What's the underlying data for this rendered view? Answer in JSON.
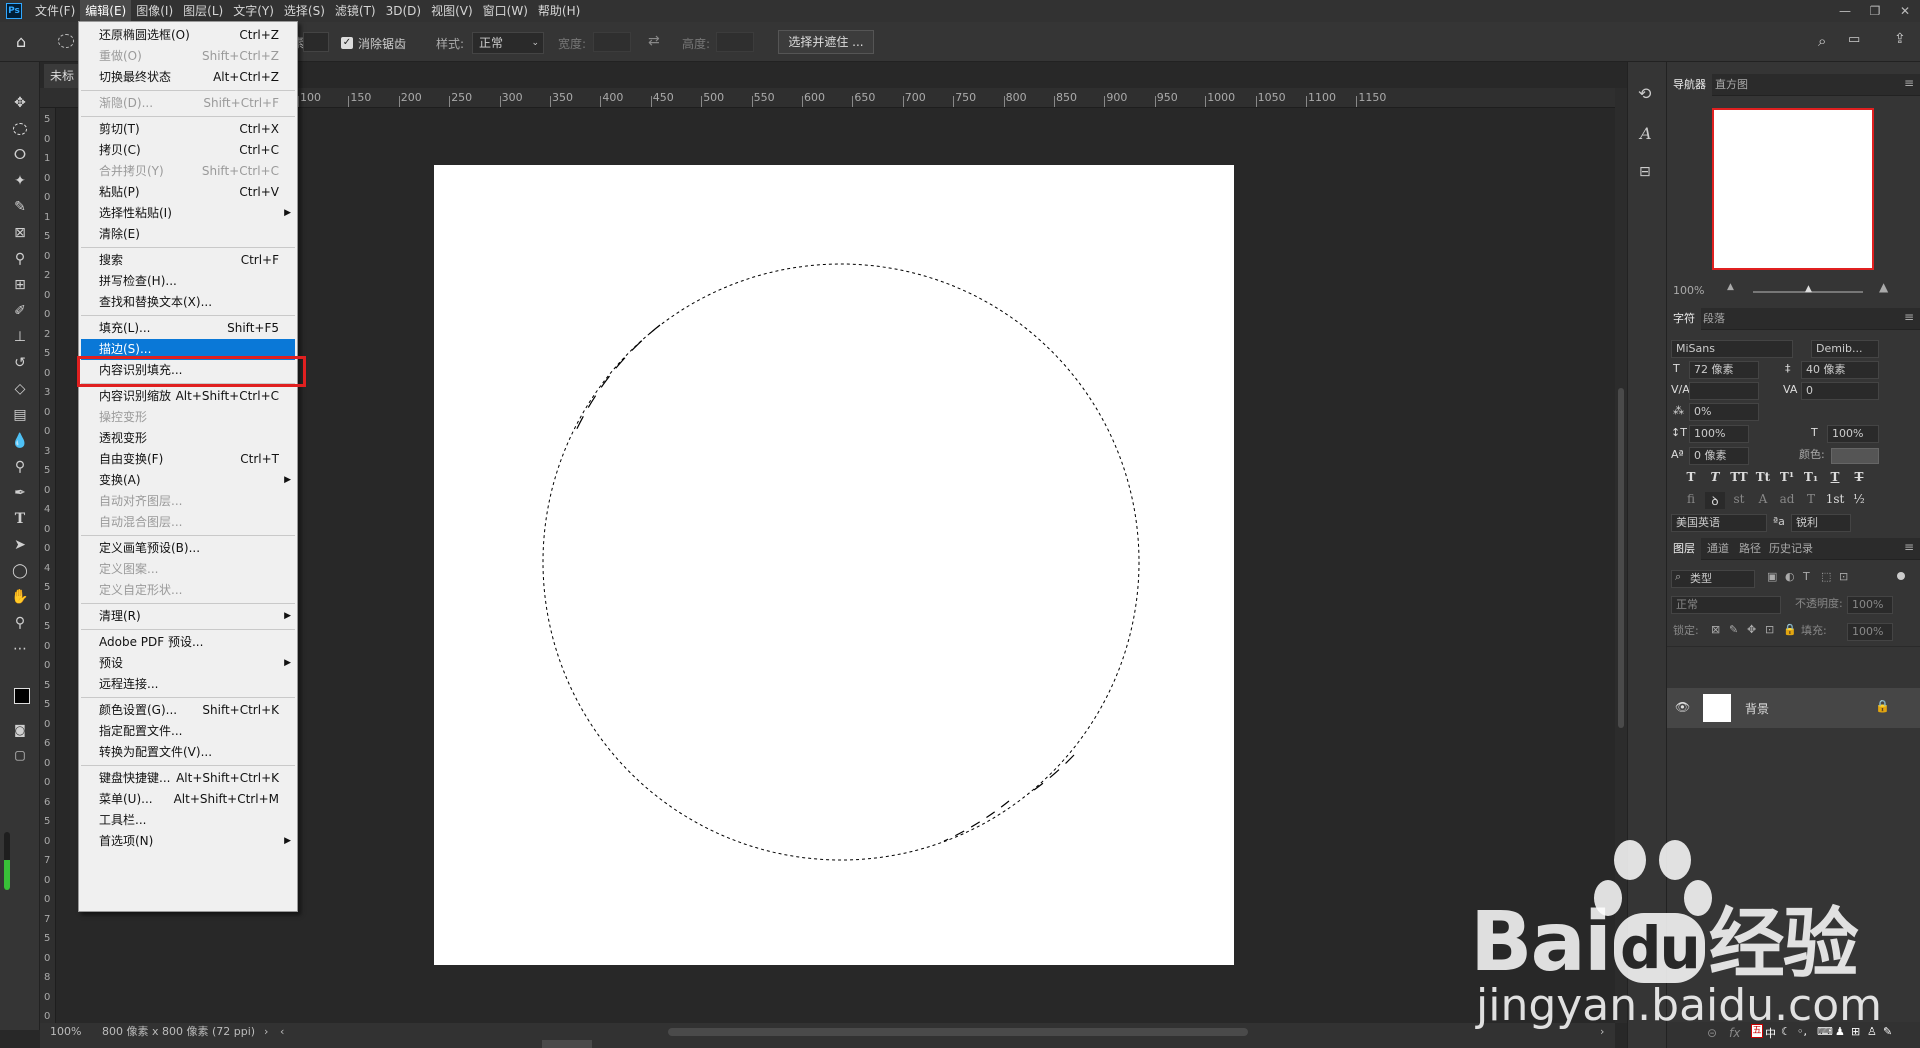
{
  "menubar": {
    "logo": "Ps",
    "items": [
      "文件(F)",
      "编辑(E)",
      "图像(I)",
      "图层(L)",
      "文字(Y)",
      "选择(S)",
      "滤镜(T)",
      "3D(D)",
      "视图(V)",
      "窗口(W)",
      "帮助(H)"
    ],
    "active_index": 1
  },
  "window_controls": [
    "—",
    "❐",
    "✕"
  ],
  "options_bar": {
    "partial_label": "素",
    "antialias_label": "消除锯齿",
    "style_label": "样式:",
    "style_value": "正常",
    "width_label": "宽度:",
    "height_label": "高度:",
    "select_mask_button": "选择并遮住 ..."
  },
  "document": {
    "tab_title": "未标",
    "zoom": "100%",
    "doc_info": "800 像素 x 800 像素 (72 ppi)"
  },
  "ruler_top_labels": [
    "100",
    "150",
    "200",
    "250",
    "300",
    "350",
    "400",
    "450",
    "500",
    "550",
    "600",
    "650",
    "700",
    "750",
    "800",
    "850",
    "900",
    "950",
    "1000",
    "1050",
    "1100",
    "1150"
  ],
  "ruler_left_labels": [
    "5",
    "0",
    "1",
    "0",
    "0",
    "1",
    "5",
    "0",
    "2",
    "0",
    "0",
    "2",
    "5",
    "0",
    "3",
    "0",
    "0",
    "3",
    "5",
    "0",
    "4",
    "0",
    "0",
    "4",
    "5",
    "0",
    "5",
    "0",
    "0",
    "5",
    "5",
    "0",
    "6",
    "0",
    "0",
    "6",
    "5",
    "0",
    "7",
    "0",
    "0",
    "7",
    "5",
    "0",
    "8",
    "0",
    "0"
  ],
  "edit_menu": {
    "items": [
      {
        "label": "还原椭圆选框(O)",
        "shortcut": "Ctrl+Z",
        "disabled": false
      },
      {
        "label": "重做(O)",
        "shortcut": "Shift+Ctrl+Z",
        "disabled": true
      },
      {
        "label": "切换最终状态",
        "shortcut": "Alt+Ctrl+Z",
        "disabled": false
      },
      {
        "sep": true
      },
      {
        "label": "渐隐(D)...",
        "shortcut": "Shift+Ctrl+F",
        "disabled": true
      },
      {
        "sep": true
      },
      {
        "label": "剪切(T)",
        "shortcut": "Ctrl+X",
        "disabled": false
      },
      {
        "label": "拷贝(C)",
        "shortcut": "Ctrl+C",
        "disabled": false
      },
      {
        "label": "合并拷贝(Y)",
        "shortcut": "Shift+Ctrl+C",
        "disabled": true
      },
      {
        "label": "粘贴(P)",
        "shortcut": "Ctrl+V",
        "disabled": false
      },
      {
        "label": "选择性粘贴(I)",
        "shortcut": "",
        "disabled": false,
        "submenu": true
      },
      {
        "label": "清除(E)",
        "shortcut": "",
        "disabled": false
      },
      {
        "sep": true
      },
      {
        "label": "搜索",
        "shortcut": "Ctrl+F",
        "disabled": false
      },
      {
        "label": "拼写检查(H)...",
        "shortcut": "",
        "disabled": false
      },
      {
        "label": "查找和替换文本(X)...",
        "shortcut": "",
        "disabled": false
      },
      {
        "sep": true
      },
      {
        "label": "填充(L)...",
        "shortcut": "Shift+F5",
        "disabled": false
      },
      {
        "label": "描边(S)...",
        "shortcut": "",
        "disabled": false,
        "highlighted": true
      },
      {
        "label": "内容识别填充...",
        "shortcut": "",
        "disabled": false
      },
      {
        "sep": true
      },
      {
        "label": "内容识别缩放",
        "shortcut": "Alt+Shift+Ctrl+C",
        "disabled": false
      },
      {
        "label": "操控变形",
        "shortcut": "",
        "disabled": true
      },
      {
        "label": "透视变形",
        "shortcut": "",
        "disabled": false
      },
      {
        "label": "自由变换(F)",
        "shortcut": "Ctrl+T",
        "disabled": false
      },
      {
        "label": "变换(A)",
        "shortcut": "",
        "disabled": false,
        "submenu": true
      },
      {
        "label": "自动对齐图层...",
        "shortcut": "",
        "disabled": true
      },
      {
        "label": "自动混合图层...",
        "shortcut": "",
        "disabled": true
      },
      {
        "sep": true
      },
      {
        "label": "定义画笔预设(B)...",
        "shortcut": "",
        "disabled": false
      },
      {
        "label": "定义图案...",
        "shortcut": "",
        "disabled": true
      },
      {
        "label": "定义自定形状...",
        "shortcut": "",
        "disabled": true
      },
      {
        "sep": true
      },
      {
        "label": "清理(R)",
        "shortcut": "",
        "disabled": false,
        "submenu": true
      },
      {
        "sep": true
      },
      {
        "label": "Adobe PDF 预设...",
        "shortcut": "",
        "disabled": false
      },
      {
        "label": "预设",
        "shortcut": "",
        "disabled": false,
        "submenu": true
      },
      {
        "label": "远程连接...",
        "shortcut": "",
        "disabled": false
      },
      {
        "sep": true
      },
      {
        "label": "颜色设置(G)...",
        "shortcut": "Shift+Ctrl+K",
        "disabled": false
      },
      {
        "label": "指定配置文件...",
        "shortcut": "",
        "disabled": false
      },
      {
        "label": "转换为配置文件(V)...",
        "shortcut": "",
        "disabled": false
      },
      {
        "sep": true
      },
      {
        "label": "键盘快捷键...",
        "shortcut": "Alt+Shift+Ctrl+K",
        "disabled": false
      },
      {
        "label": "菜单(U)...",
        "shortcut": "Alt+Shift+Ctrl+M",
        "disabled": false
      },
      {
        "label": "工具栏...",
        "shortcut": "",
        "disabled": false
      },
      {
        "label": "首选项(N)",
        "shortcut": "",
        "disabled": false,
        "submenu": true
      }
    ]
  },
  "navigator": {
    "tabs": [
      "导航器",
      "直方图"
    ],
    "zoom": "100%"
  },
  "character": {
    "tabs": [
      "字符",
      "段落"
    ],
    "font_family": "MiSans",
    "font_style": "Demib...",
    "font_size": "72 像素",
    "leading": "40 像素",
    "kerning": "",
    "tracking": "0",
    "scale_pct": "0%",
    "vertical_scale": "100%",
    "horizontal_scale": "100%",
    "baseline_shift": "0 像素",
    "color_label": "颜色:",
    "style_buttons": [
      "T",
      "T",
      "TT",
      "Tt",
      "T¹",
      "T₁",
      "T",
      "T"
    ],
    "opentype_buttons": [
      "fi",
      "ꝺ",
      "st",
      "A",
      "ad",
      "T",
      "1st",
      "½"
    ],
    "language": "美国英语",
    "aa_prefix": "ªa",
    "antialias": "锐利"
  },
  "layers": {
    "tabs": [
      "图层",
      "通道",
      "路径",
      "历史记录"
    ],
    "filter_label": "类型",
    "blend_mode": "正常",
    "opacity_label": "不透明度:",
    "opacity_value": "100%",
    "lock_label": "锁定:",
    "fill_label": "填充:",
    "fill_value": "100%",
    "layer_name": "背景"
  },
  "taskbar_tray": [
    "五",
    "中"
  ],
  "watermark": {
    "brand_left": "Bai",
    "brand_mid": "du",
    "brand_right": "经验",
    "url": "jingyan.baidu.com"
  },
  "colors": {
    "menu_highlight": "#0a78d7",
    "annotation_red": "#e02020",
    "ps_blue": "#31a8ff"
  }
}
